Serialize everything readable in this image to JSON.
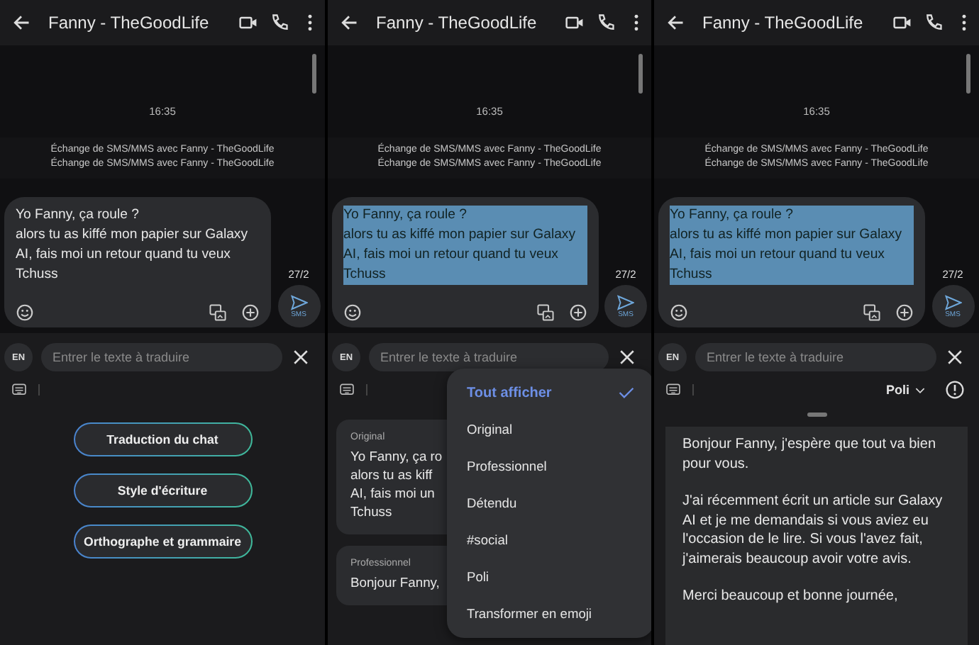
{
  "panels": [
    {
      "title": "Fanny - TheGoodLife",
      "time": "16:35",
      "info_lines": [
        "Échange de SMS/MMS avec Fanny - TheGoodLife",
        "Échange de SMS/MMS avec Fanny - TheGoodLife"
      ],
      "message": {
        "lines": [
          "Yo Fanny, ça roule ?",
          "alors tu as kiffé mon papier sur Galaxy",
          "AI, fais moi un retour quand tu veux",
          "Tchuss"
        ],
        "selected": false
      },
      "counter": "27/2",
      "send_label": "SMS",
      "translate": {
        "lang": "EN",
        "placeholder": "Entrer le texte à traduire"
      },
      "bottom": {
        "kind": "actions",
        "buttons": [
          "Traduction du chat",
          "Style d'écriture",
          "Orthographe et grammaire"
        ]
      }
    },
    {
      "title": "Fanny - TheGoodLife",
      "time": "16:35",
      "info_lines": [
        "Échange de SMS/MMS avec Fanny - TheGoodLife",
        "Échange de SMS/MMS avec Fanny - TheGoodLife"
      ],
      "message": {
        "lines": [
          "Yo Fanny, ça roule ?",
          "alors tu as kiffé mon papier sur Galaxy",
          "AI, fais moi un retour quand tu veux",
          "Tchuss"
        ],
        "selected": true
      },
      "counter": "27/2",
      "send_label": "SMS",
      "translate": {
        "lang": "EN",
        "placeholder": "Entrer le texte à traduire"
      },
      "bottom": {
        "kind": "styles",
        "cards": [
          {
            "label": "Original",
            "lines": [
              "Yo Fanny, ça ro",
              "alors tu as kiff",
              "AI, fais moi un",
              "Tchuss"
            ]
          },
          {
            "label": "Professionnel",
            "lines": [
              "Bonjour Fanny,"
            ]
          }
        ],
        "menu": [
          {
            "label": "Tout afficher",
            "selected": true
          },
          {
            "label": "Original",
            "selected": false
          },
          {
            "label": "Professionnel",
            "selected": false
          },
          {
            "label": "Détendu",
            "selected": false
          },
          {
            "label": "#social",
            "selected": false
          },
          {
            "label": "Poli",
            "selected": false
          },
          {
            "label": "Transformer en emoji",
            "selected": false
          }
        ]
      }
    },
    {
      "title": "Fanny - TheGoodLife",
      "time": "16:35",
      "info_lines": [
        "Échange de SMS/MMS avec Fanny - TheGoodLife",
        "Échange de SMS/MMS avec Fanny - TheGoodLife"
      ],
      "message": {
        "lines": [
          "Yo Fanny, ça roule ?",
          "alors tu as kiffé mon papier sur Galaxy",
          "AI, fais moi un retour quand tu veux",
          "Tchuss"
        ],
        "selected": true
      },
      "counter": "27/2",
      "send_label": "SMS",
      "translate": {
        "lang": "EN",
        "placeholder": "Entrer le texte à traduire"
      },
      "bottom": {
        "kind": "result",
        "style": "Poli",
        "paragraphs": [
          "Bonjour Fanny, j'espère que tout va bien pour vous.",
          "J'ai récemment écrit un article sur Galaxy AI et je me demandais si vous aviez eu l'occasion de le lire. Si vous l'avez fait, j'aimerais beaucoup avoir votre avis.",
          "Merci beaucoup et bonne journée,"
        ]
      }
    }
  ]
}
